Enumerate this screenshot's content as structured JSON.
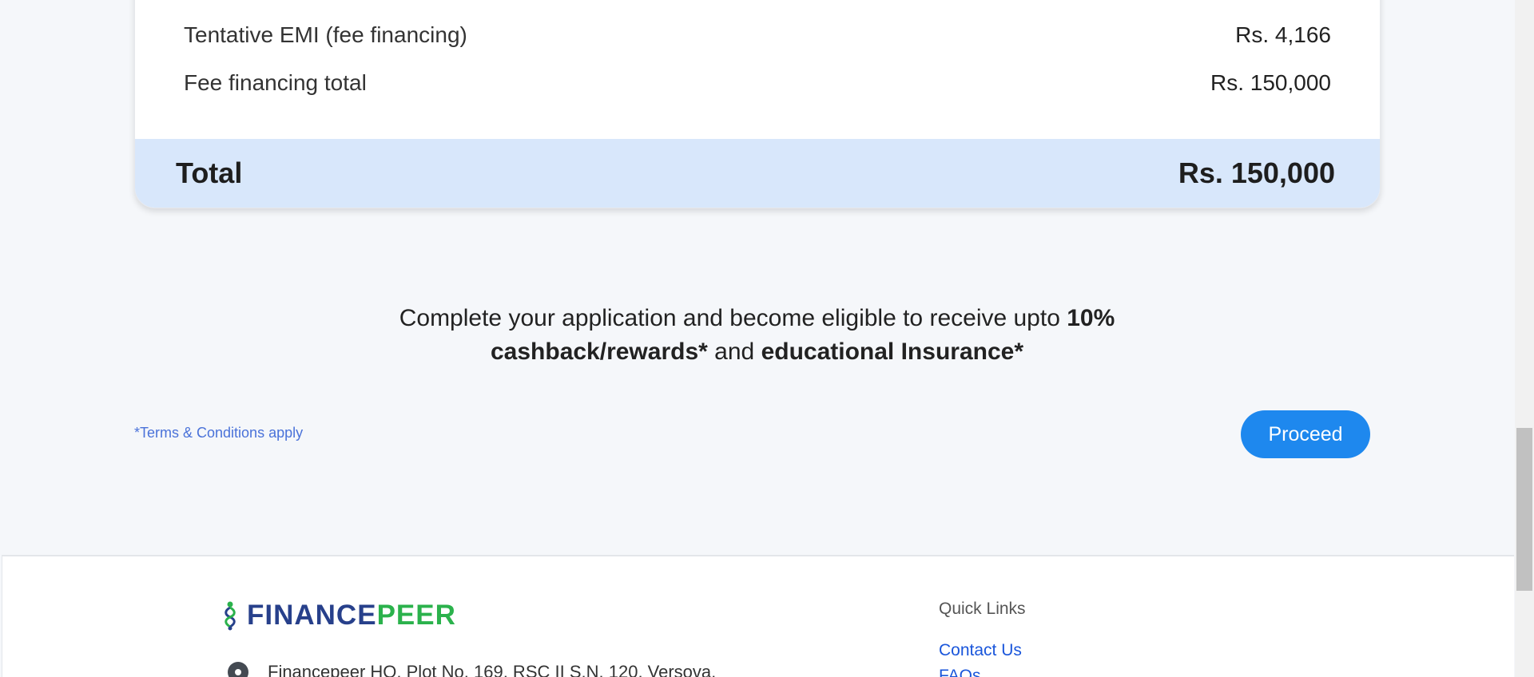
{
  "summary": {
    "rows": [
      {
        "label": "Tentative EMI (fee financing)",
        "value": "Rs. 4,166"
      },
      {
        "label": "Fee financing total",
        "value": "Rs. 150,000"
      }
    ],
    "total_label": "Total",
    "total_value": "Rs. 150,000"
  },
  "promo": {
    "part1": "Complete your application and become eligible to receive upto ",
    "bold1": "10% cashback/rewards*",
    "part2": " and ",
    "bold2": "educational Insurance*"
  },
  "terms_label": "*Terms & Conditions apply",
  "proceed_label": "Proceed",
  "footer": {
    "logo": {
      "finance": "FINANCE",
      "peer": "PEER"
    },
    "address": "Financepeer HO, Plot No. 169, RSC II S.N. 120, Versova,",
    "quick_links_title": "Quick Links",
    "links": [
      "Contact Us",
      "FAQs"
    ]
  },
  "colors": {
    "accent": "#1e88ee",
    "total_bar": "#d8e7fb",
    "logo_blue": "#27408b",
    "logo_green": "#2bb24c",
    "link": "#1a56db"
  }
}
